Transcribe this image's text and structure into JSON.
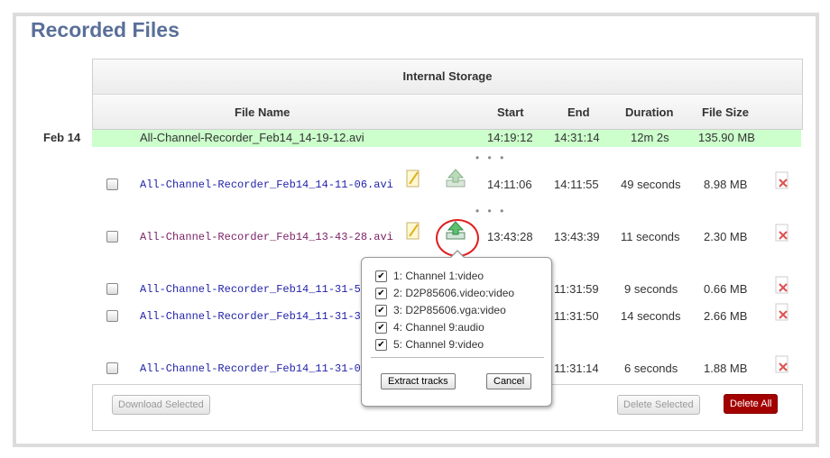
{
  "page_title": "Recorded Files",
  "storage_header": "Internal Storage",
  "columns": {
    "file_name": "File Name",
    "start": "Start",
    "end": "End",
    "duration": "Duration",
    "file_size": "File Size"
  },
  "date_group": "Feb 14",
  "current_recording": {
    "name": "All-Channel-Recorder_Feb14_14-19-12.avi",
    "start": "14:19:12",
    "end": "14:31:14",
    "duration": "12m 2s",
    "size": "135.90 MB"
  },
  "separator": "• • •",
  "files": [
    {
      "name": "All-Channel-Recorder_Feb14_14-11-06.avi",
      "start": "14:11:06",
      "end": "14:11:55",
      "duration": "49 seconds",
      "size": "8.98 MB"
    },
    {
      "name": "All-Channel-Recorder_Feb14_13-43-28.avi",
      "start": "13:43:28",
      "end": "13:43:39",
      "duration": "11 seconds",
      "size": "2.30 MB"
    },
    {
      "name": "All-Channel-Recorder_Feb14_11-31-50",
      "start": "",
      "end": "11:31:59",
      "duration": "9 seconds",
      "size": "0.66 MB"
    },
    {
      "name": "All-Channel-Recorder_Feb14_11-31-36",
      "start": "",
      "end": "11:31:50",
      "duration": "14 seconds",
      "size": "2.66 MB"
    },
    {
      "name": "All-Channel-Recorder_Feb14_11-31-08",
      "start": "",
      "end": "11:31:14",
      "duration": "6 seconds",
      "size": "1.88 MB"
    }
  ],
  "popup": {
    "tracks": [
      {
        "label": "1: Channel 1:video",
        "checked": true
      },
      {
        "label": "2: D2P85606.video:video",
        "checked": true
      },
      {
        "label": "3: D2P85606.vga:video",
        "checked": true
      },
      {
        "label": "4: Channel 9:audio",
        "checked": true
      },
      {
        "label": "5: Channel 9:video",
        "checked": true
      }
    ],
    "check_glyph": "✔",
    "extract_label": "Extract tracks",
    "cancel_label": "Cancel"
  },
  "buttons": {
    "download_selected": "Download Selected",
    "delete_selected": "Delete Selected",
    "delete_all": "Delete All"
  },
  "colors": {
    "title": "#5a6f99",
    "highlight_row": "#ccffcc",
    "link": "#2222aa",
    "visited_link": "#7a2266",
    "danger": "#a30000",
    "focus_ring": "#e02020"
  },
  "icons": {
    "note": "note-icon",
    "upload": "upload-icon",
    "delete": "delete-icon",
    "checkbox": "checkbox"
  }
}
